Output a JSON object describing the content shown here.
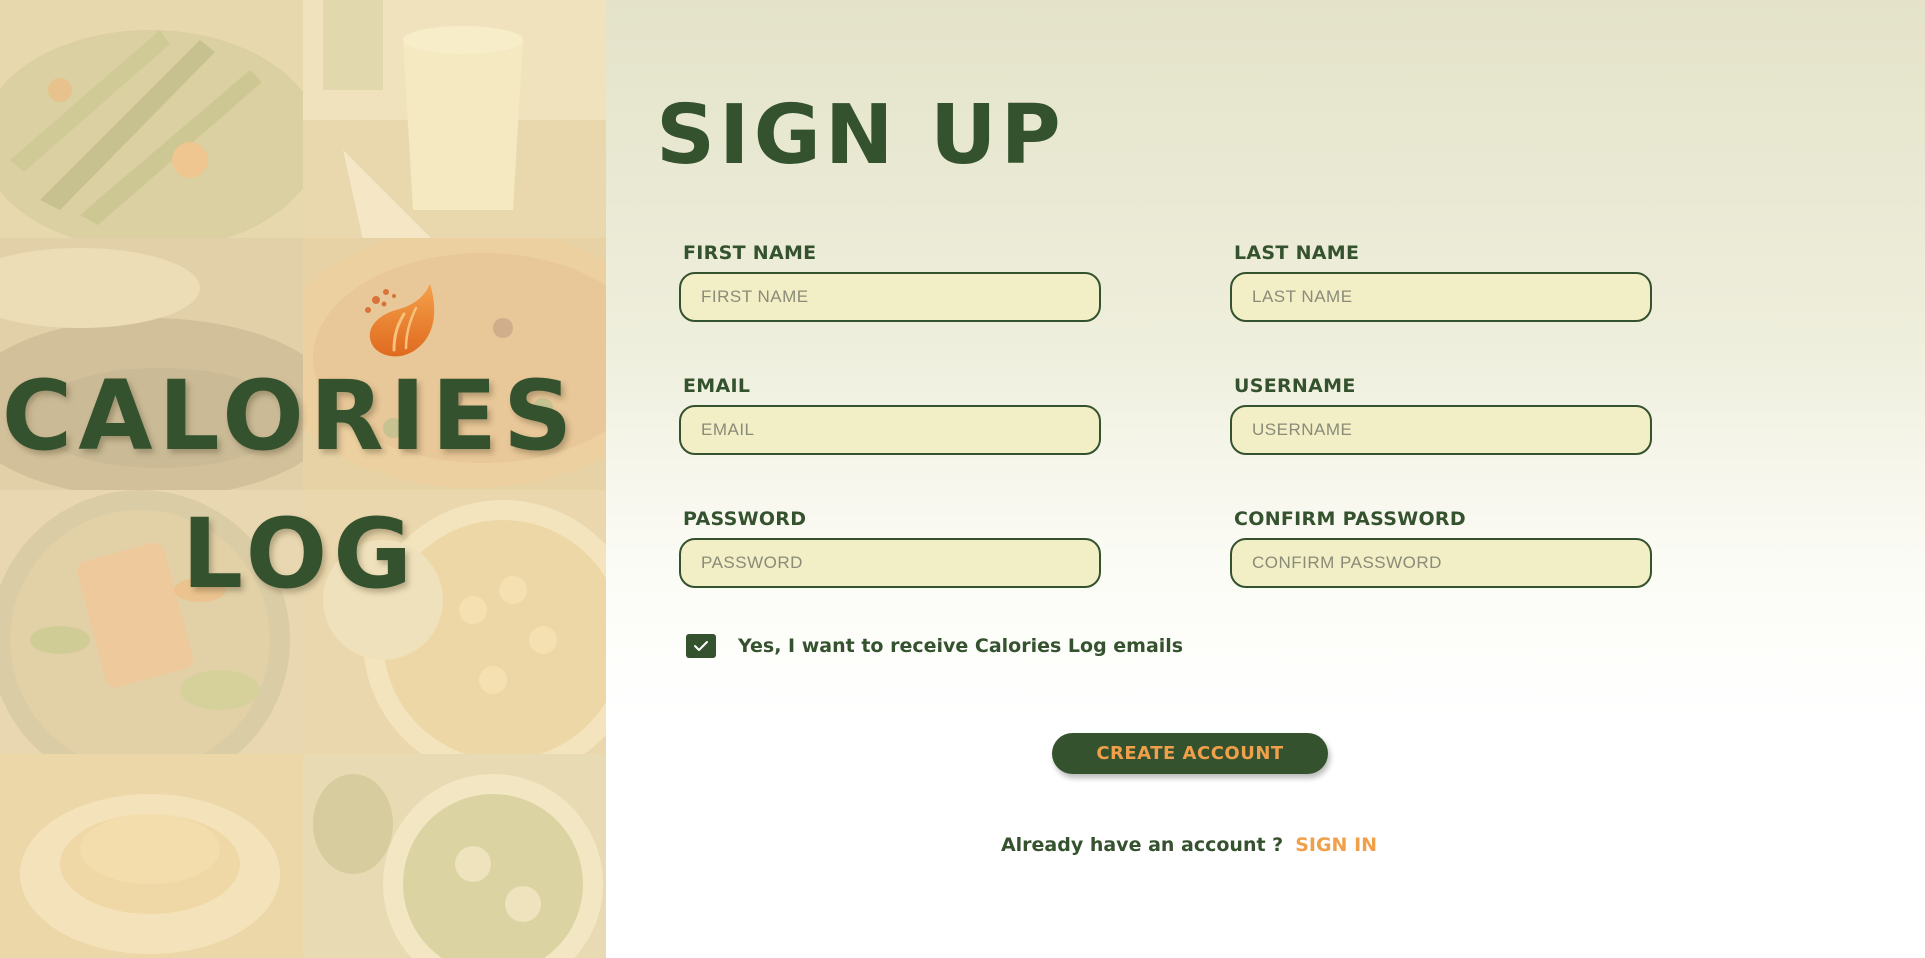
{
  "brand": {
    "line1": "CALORIES",
    "line2": "LOG",
    "logo_icon": "flame-leaf-icon"
  },
  "form": {
    "title": "SIGN UP",
    "fields": {
      "first_name": {
        "label": "FIRST NAME",
        "placeholder": "FIRST NAME",
        "value": ""
      },
      "last_name": {
        "label": "LAST NAME",
        "placeholder": "LAST NAME",
        "value": ""
      },
      "email": {
        "label": "EMAIL",
        "placeholder": "EMAIL",
        "value": ""
      },
      "username": {
        "label": "USERNAME",
        "placeholder": "USERNAME",
        "value": ""
      },
      "password": {
        "label": "PASSWORD",
        "placeholder": "PASSWORD",
        "value": ""
      },
      "confirm_password": {
        "label": "CONFIRM PASSWORD",
        "placeholder": "CONFIRM PASSWORD",
        "value": ""
      }
    },
    "optin": {
      "label": "Yes, I want to receive Calories Log emails",
      "checked": true
    },
    "submit_label": "CREATE ACCOUNT",
    "signin_prompt": "Already have an account ?",
    "signin_link": "SIGN IN"
  },
  "colors": {
    "primary_green": "#35522e",
    "accent_orange": "#f0a04b",
    "input_fill": "#f2eec6",
    "brand_panel_tint": "#f3e2b4"
  }
}
